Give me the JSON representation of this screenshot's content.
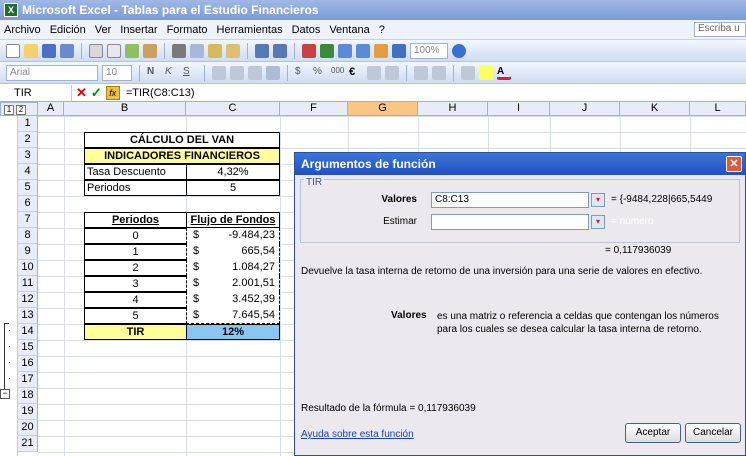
{
  "window": {
    "title": "Microsoft Excel - Tablas para el Estudio Financieros"
  },
  "menu": {
    "items": [
      "Archivo",
      "Edición",
      "Ver",
      "Insertar",
      "Formato",
      "Herramientas",
      "Datos",
      "Ventana",
      "?"
    ],
    "help_placeholder": "Escriba u"
  },
  "toolbar": {
    "zoom": "100%",
    "font": "Arial",
    "size": "10"
  },
  "formula_bar": {
    "name_box": "TIR",
    "formula": "=TIR(C8:C13)"
  },
  "columns": [
    "A",
    "B",
    "C",
    "F",
    "G",
    "H",
    "I",
    "J",
    "K",
    "L"
  ],
  "rows": [
    "1",
    "2",
    "3",
    "4",
    "5",
    "6",
    "7",
    "8",
    "9",
    "10",
    "11",
    "12",
    "13",
    "14",
    "15",
    "16",
    "17",
    "18",
    "19",
    "20",
    "21"
  ],
  "outline_levels": [
    "1",
    "2"
  ],
  "sheet": {
    "title1": "CÁLCULO DEL VAN",
    "title2": "INDICADORES FINANCIEROS",
    "tasa_label": "Tasa Descuento",
    "tasa_value": "4,32%",
    "periodos_label": "Periodos",
    "periodos_value": "5",
    "col_periodos": "Periodos",
    "col_flujo": "Flujo de Fondos",
    "currency": "$",
    "flows": [
      {
        "periodo": "0",
        "valor": "-9.484,23"
      },
      {
        "periodo": "1",
        "valor": "665,54"
      },
      {
        "periodo": "2",
        "valor": "1.084,27"
      },
      {
        "periodo": "3",
        "valor": "2.001,51"
      },
      {
        "periodo": "4",
        "valor": "3.452,39"
      },
      {
        "periodo": "5",
        "valor": "7.645,54"
      }
    ],
    "tir_label": "TIR",
    "tir_value": "12%"
  },
  "dialog": {
    "title": "Argumentos de función",
    "function": "TIR",
    "arg1_label": "Valores",
    "arg1_value": "C8:C13",
    "arg1_result": "= {-9484,228|665,5449",
    "arg2_label": "Estimar",
    "arg2_result": "= número",
    "result": "= 0,117936039",
    "description": "Devuelve la tasa interna de retorno de una inversión para una serie de valores en efectivo.",
    "help_label": "Valores",
    "help_text": "es una matriz o referencia a celdas que contengan los números para los cuales se desea calcular la tasa interna de retorno.",
    "formula_result": "Resultado de la fórmula =  0,117936039",
    "help_link": "Ayuda sobre esta función",
    "ok": "Aceptar",
    "cancel": "Cancelar"
  }
}
